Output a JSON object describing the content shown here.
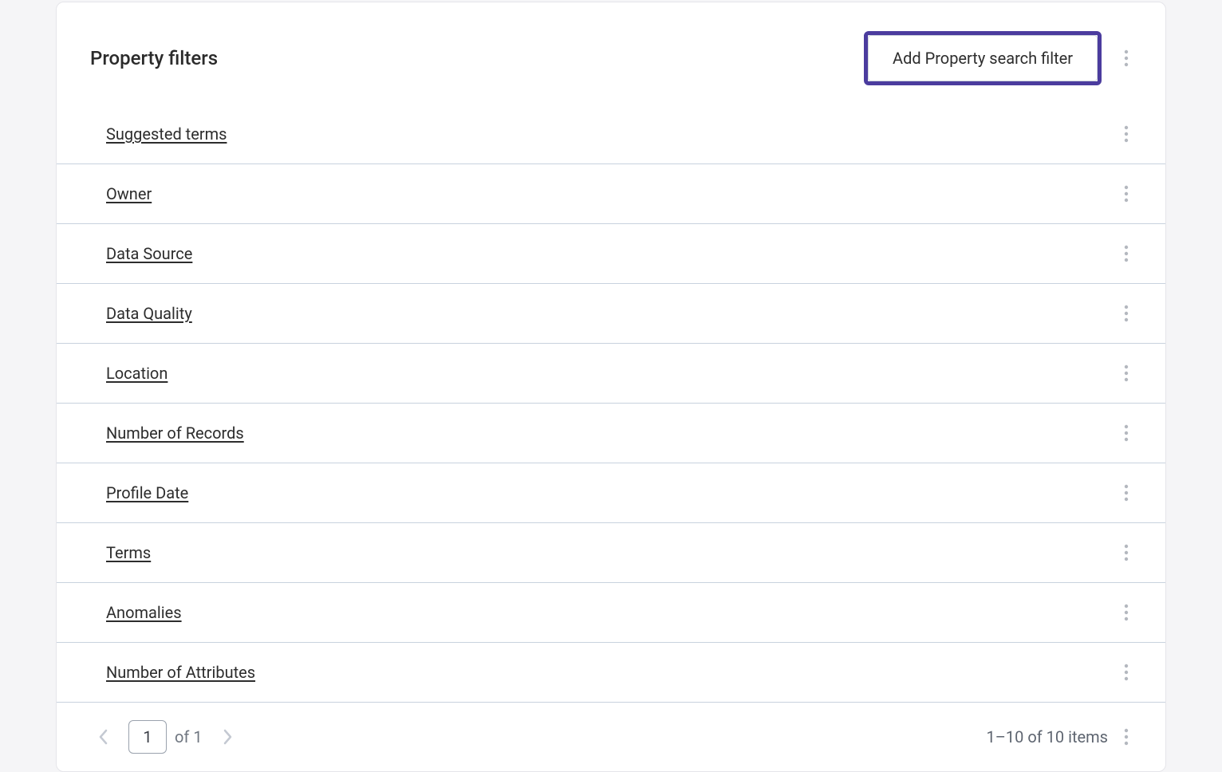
{
  "header": {
    "title": "Property filters",
    "add_button_label": "Add Property search filter"
  },
  "filters": [
    {
      "label": "Suggested terms"
    },
    {
      "label": "Owner"
    },
    {
      "label": "Data Source"
    },
    {
      "label": "Data Quality"
    },
    {
      "label": "Location"
    },
    {
      "label": "Number of Records"
    },
    {
      "label": "Profile Date"
    },
    {
      "label": "Terms"
    },
    {
      "label": "Anomalies"
    },
    {
      "label": "Number of Attributes"
    }
  ],
  "pagination": {
    "current_page": "1",
    "total_pages_label": "of 1",
    "items_summary": "1–10 of 10 items"
  }
}
